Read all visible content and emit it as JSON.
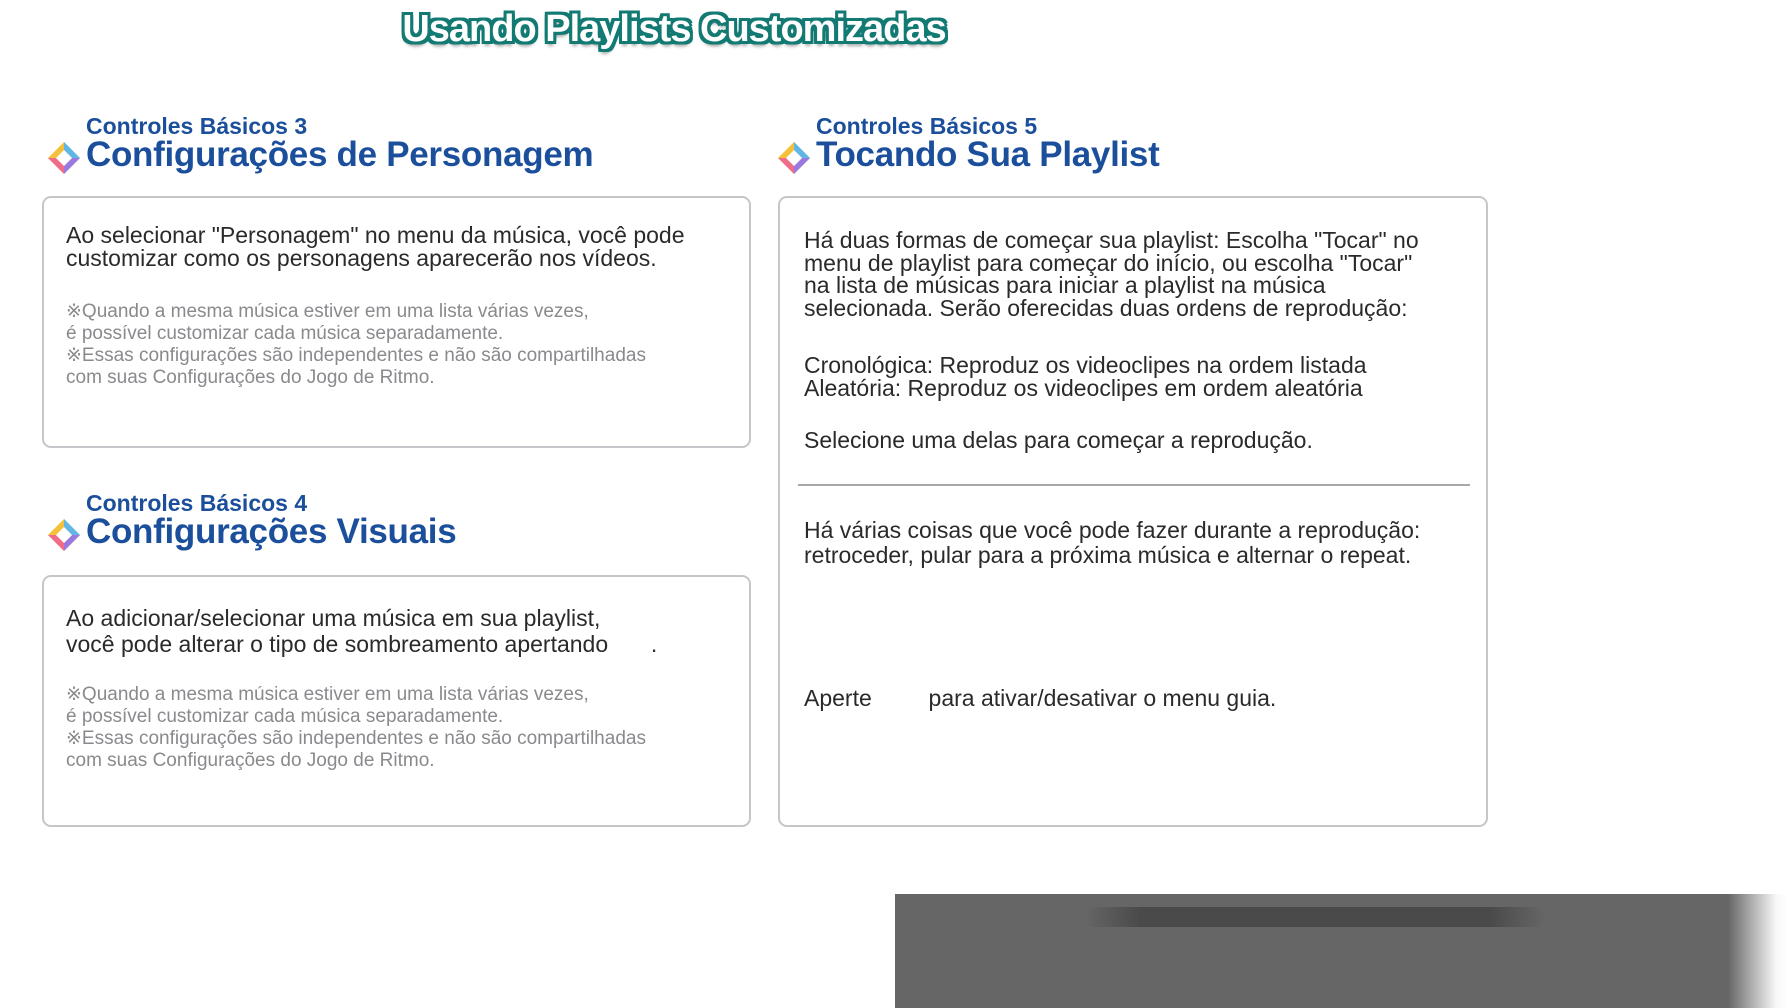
{
  "page": {
    "title": "Usando Playlists Customizadas"
  },
  "sections": [
    {
      "subtitle": "Controles Básicos 3",
      "title": "Configurações de Personagem",
      "icon": "diamond-rainbow-icon",
      "body": "Ao selecionar \"Personagem\" no menu da música, você pode\ncustomizar como os personagens aparecerão nos vídeos.",
      "notes": "※Quando a mesma música estiver em uma lista várias vezes,\n   é possível customizar cada música separadamente.\n※Essas configurações são independentes e não são compartilhadas\n   com suas Configurações do Jogo de Ritmo."
    },
    {
      "subtitle": "Controles Básicos 4",
      "title": "Configurações Visuais",
      "icon": "diamond-rainbow-icon",
      "body_line1": "Ao adicionar/selecionar uma música em sua playlist,",
      "body_line2": "você pode alterar o tipo de sombreamento apertando",
      "body_suffix": ".",
      "notes": "※Quando a mesma música estiver em uma lista várias vezes,\n   é possível customizar cada música separadamente.\n※Essas configurações são independentes e não são compartilhadas\n   com suas Configurações do Jogo de Ritmo."
    },
    {
      "subtitle": "Controles Básicos 5",
      "title": "Tocando Sua Playlist",
      "icon": "diamond-rainbow-icon",
      "para1": "Há duas formas de começar sua playlist: Escolha \"Tocar\" no\nmenu de playlist para começar do início, ou escolha \"Tocar\"\nna lista de músicas para iniciar a playlist na música\nselecionada. Serão oferecidas duas ordens de reprodução:",
      "para2": "Cronológica: Reproduz os videoclipes na ordem listada\nAleatória: Reproduz os videoclipes em ordem aleatória",
      "para3": "Selecione uma delas para começar a reprodução.",
      "para4": "Há várias coisas que você pode fazer durante a reprodução:\nretroceder, pular para a próxima música e alternar o repeat.",
      "guide_prefix": "Aperte",
      "guide_suffix": "para ativar/desativar o menu guia."
    }
  ],
  "colors": {
    "heading": "#1b4f9c",
    "title_outline": "#127a73",
    "panel_border": "#c6c6ca",
    "note_text": "#8a8a8e"
  }
}
